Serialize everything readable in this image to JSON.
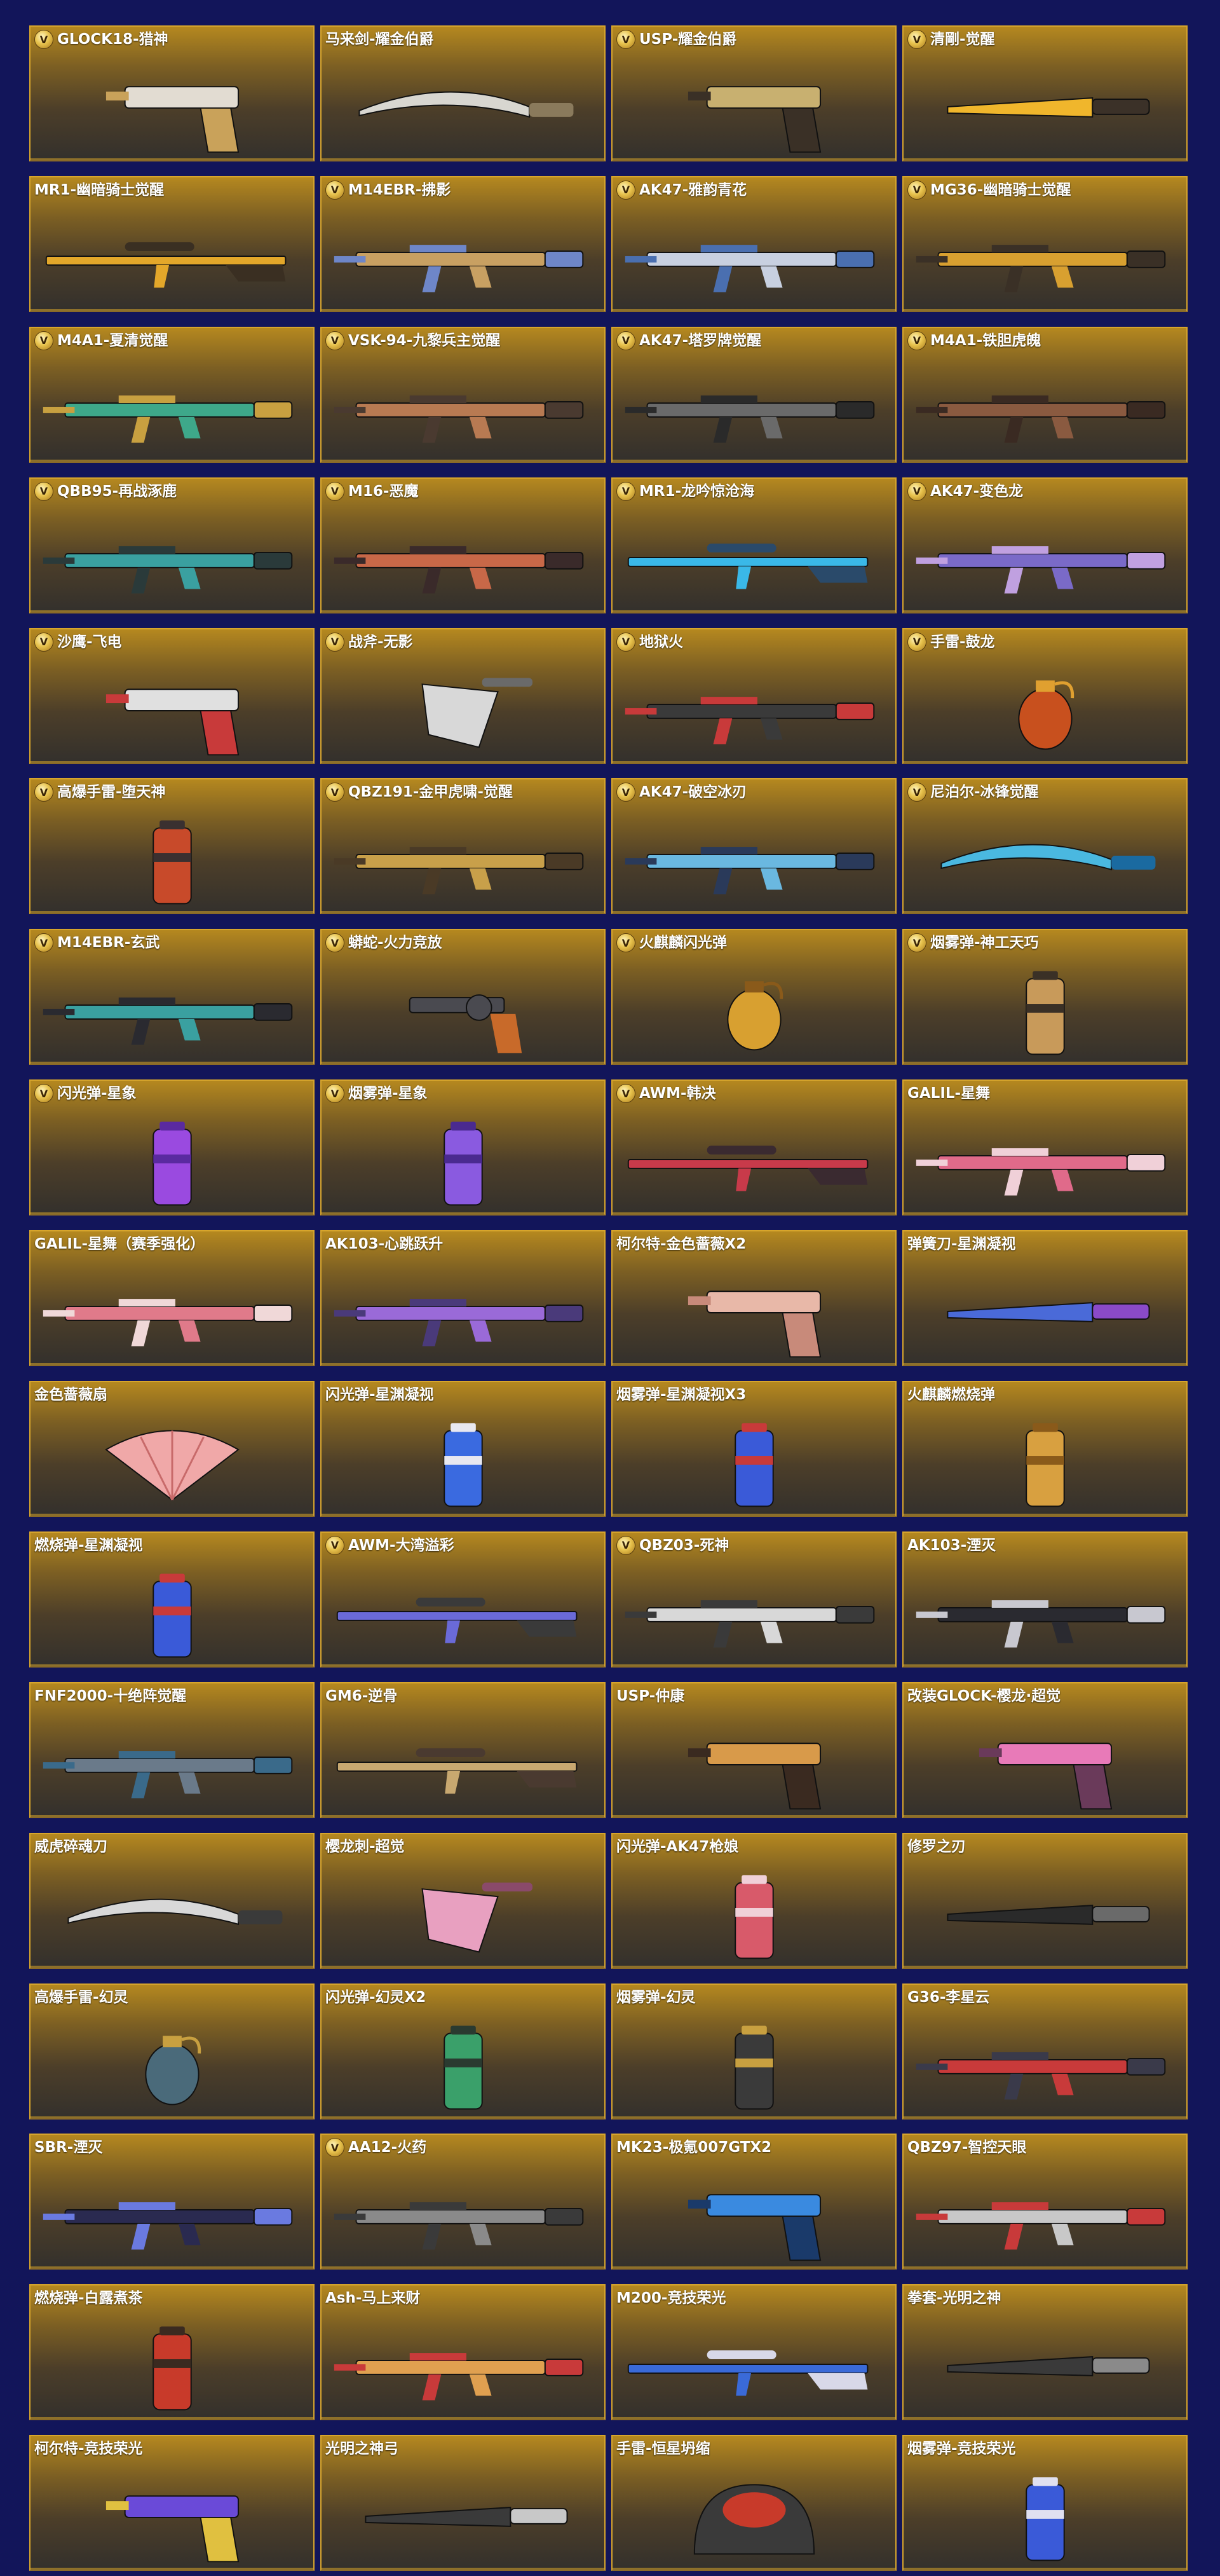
{
  "items": [
    {
      "name": "GLOCK18-猎神",
      "v": true,
      "kind": "pistol",
      "c1": "#e2dcd2",
      "c2": "#c9a25a"
    },
    {
      "name": "马来剑-耀金伯爵",
      "v": false,
      "kind": "blade",
      "c1": "#d8d6d0",
      "c2": "#8a7a5c"
    },
    {
      "name": "USP-耀金伯爵",
      "v": true,
      "kind": "pistol",
      "c1": "#c8b070",
      "c2": "#3a3026"
    },
    {
      "name": "清剛-觉醒",
      "v": true,
      "kind": "knife",
      "c1": "#f0b62c",
      "c2": "#3b3128"
    },
    {
      "name": "MR1-幽暗骑士觉醒",
      "v": false,
      "kind": "sniper",
      "c1": "#e3a72a",
      "c2": "#3a2f22"
    },
    {
      "name": "M14EBR-拂影",
      "v": true,
      "kind": "rifle",
      "c1": "#c8a062",
      "c2": "#6e86c8"
    },
    {
      "name": "AK47-雅韵青花",
      "v": true,
      "kind": "rifle",
      "c1": "#c8d0e0",
      "c2": "#4a6fb0"
    },
    {
      "name": "MG36-幽暗骑士觉醒",
      "v": true,
      "kind": "rifle",
      "c1": "#d8a030",
      "c2": "#3a3026"
    },
    {
      "name": "M4A1-夏清觉醒",
      "v": true,
      "kind": "rifle",
      "c1": "#3ea88a",
      "c2": "#c8a040"
    },
    {
      "name": "VSK-94-九黎兵主觉醒",
      "v": true,
      "kind": "rifle",
      "c1": "#b87a52",
      "c2": "#4a3a30"
    },
    {
      "name": "AK47-塔罗牌觉醒",
      "v": true,
      "kind": "rifle",
      "c1": "#6a6a6a",
      "c2": "#2a2a2a"
    },
    {
      "name": "M4A1-铁胆虎魄",
      "v": true,
      "kind": "rifle",
      "c1": "#8a5a40",
      "c2": "#3a2a22"
    },
    {
      "name": "QBB95-再战涿鹿",
      "v": true,
      "kind": "rifle",
      "c1": "#3aa0a0",
      "c2": "#2a3a3a"
    },
    {
      "name": "M16-恶魔",
      "v": true,
      "kind": "rifle",
      "c1": "#c86848",
      "c2": "#3a2a2a"
    },
    {
      "name": "MR1-龙吟惊沧海",
      "v": true,
      "kind": "sniper",
      "c1": "#3ab8e8",
      "c2": "#2a4a6a"
    },
    {
      "name": "AK47-变色龙",
      "v": true,
      "kind": "rifle",
      "c1": "#7a6ac8",
      "c2": "#c0a0e0"
    },
    {
      "name": "沙鹰-飞电",
      "v": true,
      "kind": "pistol",
      "c1": "#e0e0e0",
      "c2": "#c83a3a"
    },
    {
      "name": "战斧-无影",
      "v": true,
      "kind": "axe",
      "c1": "#d8d8d8",
      "c2": "#6a6a6a"
    },
    {
      "name": "地狱火",
      "v": true,
      "kind": "rifle",
      "c1": "#3a3a3a",
      "c2": "#c83a3a"
    },
    {
      "name": "手雷-鼓龙",
      "v": true,
      "kind": "grenade",
      "c1": "#c8501e",
      "c2": "#e0a030"
    },
    {
      "name": "高爆手雷-堕天神",
      "v": true,
      "kind": "canister",
      "c1": "#c84a2a",
      "c2": "#3a3030"
    },
    {
      "name": "QBZ191-金甲虎啸-觉醒",
      "v": true,
      "kind": "rifle",
      "c1": "#c8a04a",
      "c2": "#4a3a26"
    },
    {
      "name": "AK47-破空冰刃",
      "v": true,
      "kind": "rifle",
      "c1": "#6ab8e0",
      "c2": "#2a3a5a"
    },
    {
      "name": "尼泊尔-冰锋觉醒",
      "v": true,
      "kind": "blade",
      "c1": "#4ab8e0",
      "c2": "#1a6aa0"
    },
    {
      "name": "M14EBR-玄武",
      "v": true,
      "kind": "rifle",
      "c1": "#3aa0a0",
      "c2": "#2a2a30"
    },
    {
      "name": "蟒蛇-火力竞放",
      "v": true,
      "kind": "revolver",
      "c1": "#4a4a50",
      "c2": "#c86a2a"
    },
    {
      "name": "火麒麟闪光弹",
      "v": true,
      "kind": "grenade",
      "c1": "#d8a030",
      "c2": "#8a5a1a"
    },
    {
      "name": "烟雾弹-神工天巧",
      "v": true,
      "kind": "canister",
      "c1": "#c89a5a",
      "c2": "#3a3026"
    },
    {
      "name": "闪光弹-星象",
      "v": true,
      "kind": "canister",
      "c1": "#9a4ae0",
      "c2": "#5a2aa0"
    },
    {
      "name": "烟雾弹-星象",
      "v": true,
      "kind": "canister",
      "c1": "#8a5ae0",
      "c2": "#4a2a90"
    },
    {
      "name": "AWM-韩决",
      "v": true,
      "kind": "sniper",
      "c1": "#c83a4a",
      "c2": "#3a2a30"
    },
    {
      "name": "GALIL-星舞",
      "v": false,
      "kind": "rifle",
      "c1": "#e06a8a",
      "c2": "#f0d0d8"
    },
    {
      "name": "GALIL-星舞（赛季强化）",
      "v": false,
      "kind": "rifle",
      "c1": "#e07a8a",
      "c2": "#f0d8d8"
    },
    {
      "name": "AK103-心跳跃升",
      "v": false,
      "kind": "rifle",
      "c1": "#9a6ad8",
      "c2": "#4a3a7a"
    },
    {
      "name": "柯尔特-金色蔷薇X2",
      "v": false,
      "kind": "pistol",
      "c1": "#e8b8a8",
      "c2": "#c88a7a"
    },
    {
      "name": "弹簧刀-星渊凝视",
      "v": false,
      "kind": "knife",
      "c1": "#4a6ad8",
      "c2": "#8a4ac8"
    },
    {
      "name": "金色蔷薇扇",
      "v": false,
      "kind": "fan",
      "c1": "#f0a8a8",
      "c2": "#c86a6a"
    },
    {
      "name": "闪光弹-星渊凝视",
      "v": false,
      "kind": "canister",
      "c1": "#3a6ae0",
      "c2": "#e8e8f0"
    },
    {
      "name": "烟雾弹-星渊凝视X3",
      "v": false,
      "kind": "canister",
      "c1": "#3a5ad8",
      "c2": "#c83a3a"
    },
    {
      "name": "火麒麟燃烧弹",
      "v": false,
      "kind": "canister",
      "c1": "#d8a040",
      "c2": "#8a5a1a"
    },
    {
      "name": "燃烧弹-星渊凝视",
      "v": false,
      "kind": "canister",
      "c1": "#3a5ad8",
      "c2": "#c83a3a"
    },
    {
      "name": "AWM-大湾溢彩",
      "v": true,
      "kind": "sniper",
      "c1": "#6a6ad8",
      "c2": "#3a3a3a"
    },
    {
      "name": "QBZ03-死神",
      "v": true,
      "kind": "rifle",
      "c1": "#d8d8d8",
      "c2": "#3a3a3a"
    },
    {
      "name": "AK103-湮灭",
      "v": false,
      "kind": "rifle",
      "c1": "#2a2a30",
      "c2": "#c8c8d0"
    },
    {
      "name": "FNF2000-十绝阵觉醒",
      "v": false,
      "kind": "rifle",
      "c1": "#6a7a8a",
      "c2": "#3a6a8a"
    },
    {
      "name": "GM6-逆骨",
      "v": false,
      "kind": "sniper",
      "c1": "#c8a870",
      "c2": "#4a3a30"
    },
    {
      "name": "USP-仲康",
      "v": false,
      "kind": "pistol",
      "c1": "#d89a4a",
      "c2": "#3a2a20"
    },
    {
      "name": "改装GLOCK-樱龙·超觉",
      "v": false,
      "kind": "pistol",
      "c1": "#e87ab8",
      "c2": "#6a3a5a"
    },
    {
      "name": "威虎碎魂刀",
      "v": false,
      "kind": "blade",
      "c1": "#d8d8d8",
      "c2": "#3a3a3a"
    },
    {
      "name": "樱龙刺-超觉",
      "v": false,
      "kind": "axe",
      "c1": "#e8a0c0",
      "c2": "#8a4a6a"
    },
    {
      "name": "闪光弹-AK47枪娘",
      "v": false,
      "kind": "canister",
      "c1": "#d85a6a",
      "c2": "#f0d0d8"
    },
    {
      "name": "修罗之刃",
      "v": false,
      "kind": "knife",
      "c1": "#2a2a2a",
      "c2": "#6a6a6a"
    },
    {
      "name": "高爆手雷-幻灵",
      "v": false,
      "kind": "grenade",
      "c1": "#4a6a7a",
      "c2": "#c8a040"
    },
    {
      "name": "闪光弹-幻灵X2",
      "v": false,
      "kind": "canister",
      "c1": "#3aa06a",
      "c2": "#2a3a30"
    },
    {
      "name": "烟雾弹-幻灵",
      "v": false,
      "kind": "canister",
      "c1": "#3a3a3a",
      "c2": "#c8a040"
    },
    {
      "name": "G36-李星云",
      "v": false,
      "kind": "rifle",
      "c1": "#c83a3a",
      "c2": "#3a3a4a"
    },
    {
      "name": "SBR-湮灭",
      "v": false,
      "kind": "rifle",
      "c1": "#2a2a50",
      "c2": "#6a7ae0"
    },
    {
      "name": "AA12-火药",
      "v": true,
      "kind": "rifle",
      "c1": "#8a8a8a",
      "c2": "#3a3a3a"
    },
    {
      "name": "MK23-极氪007GTX2",
      "v": false,
      "kind": "pistol",
      "c1": "#3a8ae0",
      "c2": "#1a3a6a"
    },
    {
      "name": "QBZ97-智控天眼",
      "v": false,
      "kind": "rifle",
      "c1": "#c8c8c8",
      "c2": "#c83a3a"
    },
    {
      "name": "燃烧弹-白露煮茶",
      "v": false,
      "kind": "canister",
      "c1": "#c83a2a",
      "c2": "#3a2a20"
    },
    {
      "name": "Ash-马上来财",
      "v": false,
      "kind": "rifle",
      "c1": "#e0a050",
      "c2": "#c83a3a"
    },
    {
      "name": "M200-竞技荣光",
      "v": false,
      "kind": "sniper",
      "c1": "#3a6ad8",
      "c2": "#d8d8e8"
    },
    {
      "name": "拳套-光明之神",
      "v": false,
      "kind": "knife",
      "c1": "#3a3a3a",
      "c2": "#8a8a8a"
    },
    {
      "name": "柯尔特-竞技荣光",
      "v": false,
      "kind": "pistol",
      "c1": "#6a4ad8",
      "c2": "#e0c040"
    },
    {
      "name": "光明之神弓",
      "v": false,
      "kind": "knife",
      "c1": "#3a3a3a",
      "c2": "#c8c8c8"
    },
    {
      "name": "手雷-恒星坍缩",
      "v": false,
      "kind": "helmet",
      "c1": "#c83a2a",
      "c2": "#3a3a3a"
    },
    {
      "name": "烟雾弹-竞技荣光",
      "v": false,
      "kind": "canister",
      "c1": "#3a5ad8",
      "c2": "#e0e0f0"
    }
  ]
}
